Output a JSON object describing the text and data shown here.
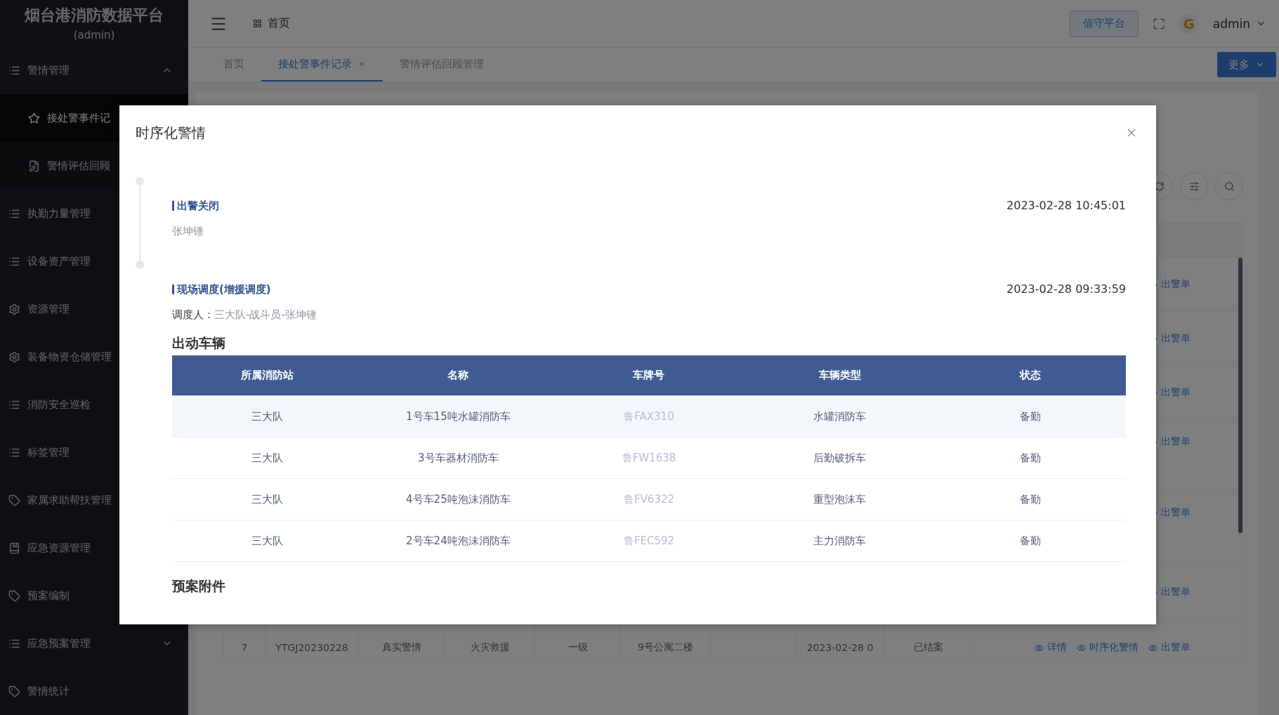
{
  "sidebar": {
    "title": "烟台港消防数据平台",
    "subtitle": "(admin)",
    "items": [
      {
        "label": "警情管理",
        "kind": "list",
        "expanded": true,
        "children": [
          {
            "label": "接处警事件记",
            "kind": "star",
            "selected": true
          },
          {
            "label": "警情评估回顾",
            "kind": "edit",
            "selected": false
          }
        ]
      },
      {
        "label": "执勤力量管理",
        "kind": "list"
      },
      {
        "label": "设备资产管理",
        "kind": "list"
      },
      {
        "label": "资源管理",
        "kind": "gear"
      },
      {
        "label": "装备物资仓储管理",
        "kind": "gear"
      },
      {
        "label": "消防安全巡检",
        "kind": "list"
      },
      {
        "label": "标签管理",
        "kind": "list"
      },
      {
        "label": "家属求助帮扶管理",
        "kind": "tag"
      },
      {
        "label": "应急资源管理",
        "kind": "book"
      },
      {
        "label": "预案编制",
        "kind": "tag"
      },
      {
        "label": "应急预案管理",
        "kind": "list",
        "expanded": false
      },
      {
        "label": "警情统计",
        "kind": "tag"
      }
    ]
  },
  "header": {
    "breadcrumb": "首页",
    "duty_button": "值守平台",
    "avatar": "G",
    "user": "admin",
    "tabs": [
      {
        "label": "首页",
        "selected": false,
        "closable": false
      },
      {
        "label": "接处警事件记录",
        "selected": true,
        "closable": true
      },
      {
        "label": "警情评估回顾管理",
        "selected": false,
        "closable": false
      }
    ],
    "more_button": "更多"
  },
  "table": {
    "rows": [
      {
        "cells": [],
        "actions": [
          "出警单"
        ]
      },
      {
        "cells": [],
        "actions": [
          "出警单"
        ]
      },
      {
        "cells": [],
        "actions": [
          "出警单"
        ]
      },
      {
        "cells": [],
        "actions": [
          "出警单"
        ]
      },
      {
        "cells": [],
        "actions": [
          "出警单"
        ]
      },
      {
        "cells": [],
        "actions": [
          "出警单"
        ]
      },
      {
        "cells": [
          "7",
          "YTGJ20230228",
          "真实警情",
          "火灾救援",
          "一级",
          "9号公寓二楼",
          "",
          "2023-02-28 0",
          "已结案"
        ],
        "actions": [
          "详情",
          "时序化警情",
          "出警单"
        ]
      }
    ]
  },
  "dialog": {
    "title": "时序化警情",
    "timeline": [
      {
        "title": "出警关闭",
        "time": "2023-02-28 10:45:01",
        "lines": [
          {
            "value": "张坤锺"
          }
        ]
      },
      {
        "title": "现场调度(增援调度)",
        "time": "2023-02-28 09:33:59",
        "lines": [
          {
            "label": "调度人：",
            "value": "三大队-战斗员-张坤锺"
          }
        ],
        "vehicles": {
          "heading": "出动车辆",
          "columns": [
            "所属消防站",
            "名称",
            "车牌号",
            "车辆类型",
            "状态"
          ],
          "rows": [
            {
              "cells": [
                "三大队",
                "1号车15吨水罐消防车",
                "鲁FAX310",
                "水罐消防车",
                "备勤"
              ],
              "highlighted": true
            },
            {
              "cells": [
                "三大队",
                "3号车器材消防车",
                "鲁FW1638",
                "后勤破拆车",
                "备勤"
              ],
              "highlighted": false
            },
            {
              "cells": [
                "三大队",
                "4号车25吨泡沫消防车",
                "鲁FV6322",
                "重型泡沫车",
                "备勤"
              ],
              "highlighted": false
            },
            {
              "cells": [
                "三大队",
                "2号车24吨泡沫消防车",
                "鲁FEC592",
                "主力消防车",
                "备勤"
              ],
              "highlighted": false
            }
          ]
        },
        "attachments_heading": "预案附件"
      }
    ]
  }
}
